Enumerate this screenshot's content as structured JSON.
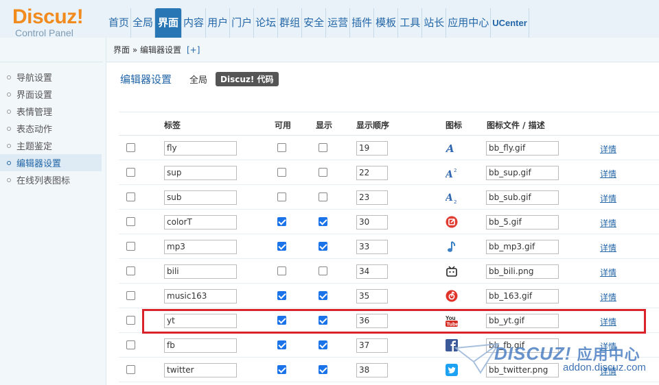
{
  "logo": {
    "brand": "Discuz!",
    "subtitle": "Control Panel"
  },
  "nav": [
    "首页",
    "全局",
    "界面",
    "内容",
    "用户",
    "门户",
    "论坛",
    "群组",
    "安全",
    "运营",
    "插件",
    "模板",
    "工具",
    "站长",
    "应用中心",
    "UCenter"
  ],
  "breadcrumb": {
    "path": "界面 » 编辑器设置",
    "add": "[+]"
  },
  "sidebar": [
    {
      "label": "导航设置"
    },
    {
      "label": "界面设置"
    },
    {
      "label": "表情管理"
    },
    {
      "label": "表态动作"
    },
    {
      "label": "主题鉴定"
    },
    {
      "label": "编辑器设置",
      "active": true
    },
    {
      "label": "在线列表图标"
    }
  ],
  "page": {
    "title": "编辑器设置",
    "tab_global": "全局",
    "tab_code": "Discuz! 代码"
  },
  "table": {
    "headers": {
      "tag": "标签",
      "available": "可用",
      "show": "显示",
      "order": "显示顺序",
      "icon": "图标",
      "file": "图标文件 / 描述"
    },
    "rows": [
      {
        "tag": "fly",
        "available": false,
        "show": false,
        "order": "19",
        "icon": "font-fly-icon",
        "file": "bb_fly.gif",
        "detail": "详情"
      },
      {
        "tag": "sup",
        "available": false,
        "show": false,
        "order": "22",
        "icon": "superscript-icon",
        "file": "bb_sup.gif",
        "detail": "详情"
      },
      {
        "tag": "sub",
        "available": false,
        "show": false,
        "order": "23",
        "icon": "subscript-icon",
        "file": "bb_sub.gif",
        "detail": "详情"
      },
      {
        "tag": "colorT",
        "available": true,
        "show": true,
        "order": "30",
        "icon": "color-edit-icon",
        "file": "bb_5.gif",
        "detail": "详情"
      },
      {
        "tag": "mp3",
        "available": true,
        "show": true,
        "order": "33",
        "icon": "music-note-icon",
        "file": "bb_mp3.gif",
        "detail": "详情"
      },
      {
        "tag": "bili",
        "available": false,
        "show": false,
        "order": "34",
        "icon": "bilibili-icon",
        "file": "bb_bili.png",
        "detail": "详情"
      },
      {
        "tag": "music163",
        "available": true,
        "show": true,
        "order": "35",
        "icon": "netease-music-icon",
        "file": "bb_163.gif",
        "detail": "详情"
      },
      {
        "tag": "yt",
        "available": true,
        "show": true,
        "order": "36",
        "icon": "youtube-icon",
        "file": "bb_yt.gif",
        "detail": "详情"
      },
      {
        "tag": "fb",
        "available": true,
        "show": true,
        "order": "37",
        "icon": "facebook-icon",
        "file": "bb_fb.gif",
        "detail": "详情"
      },
      {
        "tag": "twitter",
        "available": true,
        "show": true,
        "order": "38",
        "icon": "twitter-icon",
        "file": "bb_twitter.png",
        "detail": "详情"
      }
    ]
  },
  "watermark": {
    "brand": "DISCUZ!",
    "brand_cn": "应用中心",
    "url": "addon.discuz.com"
  },
  "colors": {
    "accent": "#2877b4",
    "logo_orange": "#f28b1e",
    "highlight": "#d9222a",
    "checkbox": "#1a73e8"
  }
}
